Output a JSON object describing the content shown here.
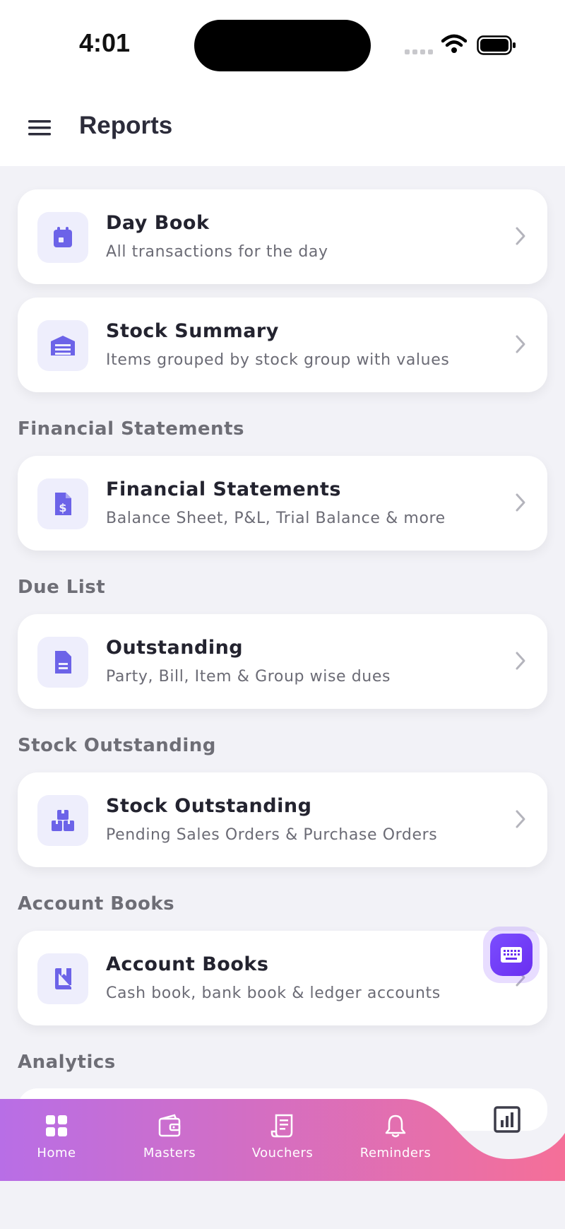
{
  "status_bar": {
    "time": "4:01"
  },
  "header": {
    "title": "Reports"
  },
  "cards": [
    {
      "title": "Day Book",
      "subtitle": "All transactions for the day",
      "icon": "calendar-icon"
    },
    {
      "title": "Stock Summary",
      "subtitle": "Items grouped by stock group with values",
      "icon": "warehouse-icon"
    },
    {
      "title": "Financial Statements",
      "subtitle": "Balance Sheet, P&L, Trial Balance & more",
      "icon": "dollar-document-icon"
    },
    {
      "title": "Outstanding",
      "subtitle": "Party, Bill, Item & Group wise dues",
      "icon": "document-icon"
    },
    {
      "title": "Stock Outstanding",
      "subtitle": "Pending Sales Orders & Purchase Orders",
      "icon": "boxes-icon"
    },
    {
      "title": "Account Books",
      "subtitle": "Cash book, bank book & ledger accounts",
      "icon": "book-icon"
    }
  ],
  "sections": [
    "Financial Statements",
    "Due List",
    "Stock Outstanding",
    "Account Books",
    "Analytics"
  ],
  "tabs": [
    {
      "label": "Home",
      "icon": "grid-icon"
    },
    {
      "label": "Masters",
      "icon": "wallet-icon"
    },
    {
      "label": "Vouchers",
      "icon": "receipt-icon"
    },
    {
      "label": "Reminders",
      "icon": "bell-icon"
    }
  ],
  "active_tab_icon": "bar-chart-icon",
  "colors": {
    "accent": "#6c63e8",
    "tab_gradient_start": "#b86ee6",
    "tab_gradient_end": "#f56f98",
    "fab": "#7b4dff"
  }
}
